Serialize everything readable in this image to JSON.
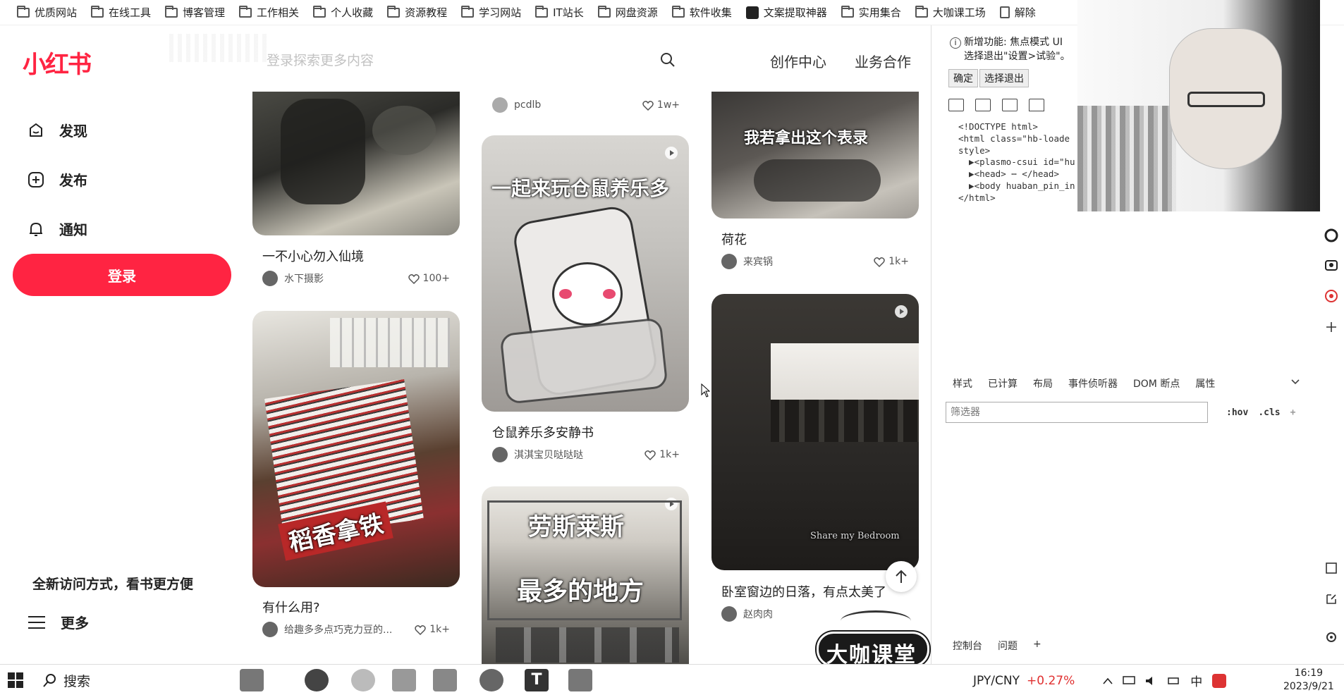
{
  "bookmarks": [
    {
      "label": "优质网站",
      "icon": "folder-icon"
    },
    {
      "label": "在线工具",
      "icon": "folder-icon"
    },
    {
      "label": "博客管理",
      "icon": "folder-icon"
    },
    {
      "label": "工作相关",
      "icon": "folder-icon"
    },
    {
      "label": "个人收藏",
      "icon": "folder-icon"
    },
    {
      "label": "资源教程",
      "icon": "folder-icon"
    },
    {
      "label": "学习网站",
      "icon": "folder-icon"
    },
    {
      "label": "IT站长",
      "icon": "folder-icon"
    },
    {
      "label": "网盘资源",
      "icon": "folder-icon"
    },
    {
      "label": "软件收集",
      "icon": "folder-icon"
    },
    {
      "label": "文案提取神器",
      "icon": "app-icon"
    },
    {
      "label": "实用集合",
      "icon": "folder-icon"
    },
    {
      "label": "大咖课工场",
      "icon": "folder-icon"
    },
    {
      "label": "解除",
      "icon": "document-icon"
    }
  ],
  "brand": {
    "logo": "小红书",
    "accent": "#ff2442"
  },
  "sidebar": {
    "items": [
      {
        "label": "发现",
        "icon": "discover-icon"
      },
      {
        "label": "发布",
        "icon": "publish-icon"
      },
      {
        "label": "通知",
        "icon": "bell-icon"
      }
    ],
    "login": "登录",
    "promo": "全新访问方式，看书更方便",
    "more": "更多"
  },
  "header": {
    "search_placeholder": "登录探索更多内容",
    "creator_center": "创作中心",
    "business": "业务合作"
  },
  "feed": {
    "col1": [
      {
        "title": "一不小心勿入仙境",
        "author": "水下摄影",
        "likes": "100+"
      },
      {
        "title": "有什么用?",
        "author": "给趣多多点巧克力豆的...",
        "likes": "1k+",
        "caption": "稻香拿铁"
      }
    ],
    "col2": [
      {
        "author": "pcdlb",
        "likes": "1w+"
      },
      {
        "title": "仓鼠养乐多安静书",
        "author": "淇淇宝贝哒哒哒",
        "likes": "1k+",
        "caption": "一起来玩仓鼠养乐多"
      },
      {
        "caption_top": "劳斯莱斯",
        "caption_bottom": "最多的地方"
      }
    ],
    "col3": [
      {
        "title": "荷花",
        "author": "来宾锅",
        "likes": "1k+",
        "caption": "我若拿出这个表录"
      },
      {
        "title": "卧室窗边的日落，有点太美了",
        "author": "赵肉肉",
        "caption": "Share my Bedroom"
      }
    ]
  },
  "watermark": "大咖课堂",
  "devtools": {
    "notice_line1": "新增功能: 焦点模式 UI",
    "notice_line2": "选择退出\"设置>试验\"。",
    "btn_ok": "确定",
    "btn_optout": "选择退出",
    "code": [
      "<!DOCTYPE html>",
      "<html class=\"hb-loade",
      "style>",
      "  ▶<plasmo-csui id=\"hu",
      "  ▶<head> ⋯ </head>",
      "  ▶<body huaban_pin_in",
      "</html>"
    ],
    "tabs": [
      "样式",
      "已计算",
      "布局",
      "事件侦听器",
      "DOM 断点",
      "属性"
    ],
    "filter_placeholder": "筛选器",
    "filter_tools": [
      ":hov",
      ".cls",
      "+"
    ],
    "bottom_tabs": [
      "控制台",
      "问题",
      "+"
    ]
  },
  "taskbar": {
    "search": "搜索",
    "currency": "JPY/CNY",
    "change": "+0.27%",
    "change_color": "#e03030",
    "ime": "中",
    "time": "16:19",
    "date": "2023/9/21"
  }
}
